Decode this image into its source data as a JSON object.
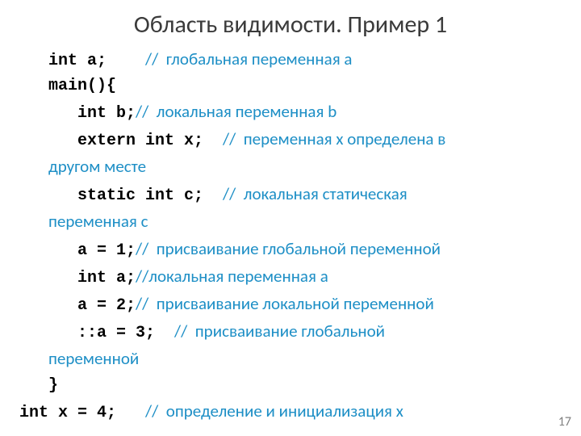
{
  "title": "Область видимости. Пример 1",
  "lines": {
    "l1_code": "int a;    ",
    "l1_cmt": "//  глобальная переменная a",
    "l2_code": "main(){",
    "l3_code": "int b;",
    "l3_cmt": "//  локальная переменная b",
    "l4_code": "extern int x;  ",
    "l4_cmt": "//  переменная x определена в",
    "l4_cmt2": "другом месте",
    "l5_code": "static int c;  ",
    "l5_cmt": "//  локальная статическая",
    "l5_cmt2": "переменная c",
    "l6_code": "a = 1;",
    "l6_cmt": "//  присваивание глобальной переменной",
    "l7_code": "int a;",
    "l7_cmt": "//локальная переменная a",
    "l8_code": "a = 2;",
    "l8_cmt": "//  присваивание локальной переменной",
    "l9_code": "::a = 3;  ",
    "l9_cmt": "//  присваивание глобальной",
    "l9_cmt2": "переменной",
    "l10_code": "}",
    "l11_code": "int x = 4;   ",
    "l11_cmt": "//  определение и инициализация x"
  },
  "pagenum": "17"
}
